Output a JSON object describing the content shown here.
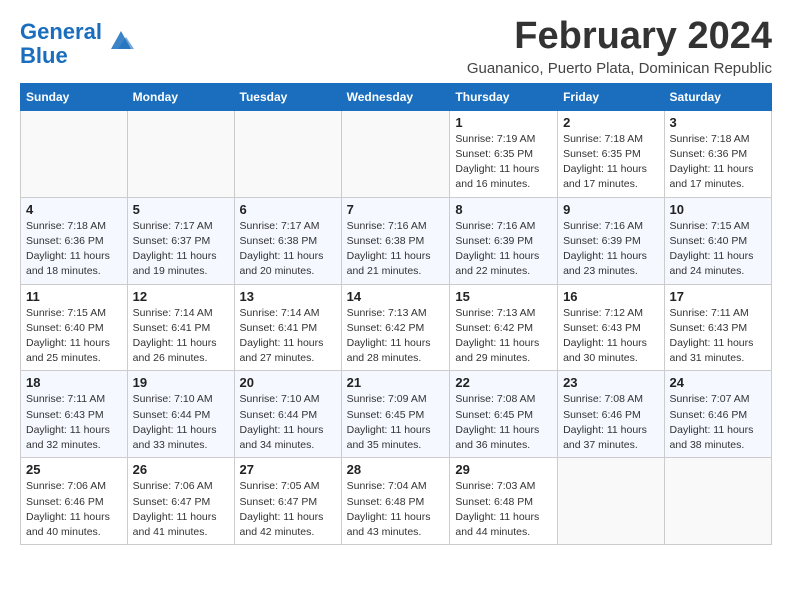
{
  "logo": {
    "text_general": "General",
    "text_blue": "Blue"
  },
  "title": "February 2024",
  "subtitle": "Guananico, Puerto Plata, Dominican Republic",
  "days_of_week": [
    "Sunday",
    "Monday",
    "Tuesday",
    "Wednesday",
    "Thursday",
    "Friday",
    "Saturday"
  ],
  "weeks": [
    [
      {
        "day": "",
        "info": ""
      },
      {
        "day": "",
        "info": ""
      },
      {
        "day": "",
        "info": ""
      },
      {
        "day": "",
        "info": ""
      },
      {
        "day": "1",
        "info": "Sunrise: 7:19 AM\nSunset: 6:35 PM\nDaylight: 11 hours and 16 minutes."
      },
      {
        "day": "2",
        "info": "Sunrise: 7:18 AM\nSunset: 6:35 PM\nDaylight: 11 hours and 17 minutes."
      },
      {
        "day": "3",
        "info": "Sunrise: 7:18 AM\nSunset: 6:36 PM\nDaylight: 11 hours and 17 minutes."
      }
    ],
    [
      {
        "day": "4",
        "info": "Sunrise: 7:18 AM\nSunset: 6:36 PM\nDaylight: 11 hours and 18 minutes."
      },
      {
        "day": "5",
        "info": "Sunrise: 7:17 AM\nSunset: 6:37 PM\nDaylight: 11 hours and 19 minutes."
      },
      {
        "day": "6",
        "info": "Sunrise: 7:17 AM\nSunset: 6:38 PM\nDaylight: 11 hours and 20 minutes."
      },
      {
        "day": "7",
        "info": "Sunrise: 7:16 AM\nSunset: 6:38 PM\nDaylight: 11 hours and 21 minutes."
      },
      {
        "day": "8",
        "info": "Sunrise: 7:16 AM\nSunset: 6:39 PM\nDaylight: 11 hours and 22 minutes."
      },
      {
        "day": "9",
        "info": "Sunrise: 7:16 AM\nSunset: 6:39 PM\nDaylight: 11 hours and 23 minutes."
      },
      {
        "day": "10",
        "info": "Sunrise: 7:15 AM\nSunset: 6:40 PM\nDaylight: 11 hours and 24 minutes."
      }
    ],
    [
      {
        "day": "11",
        "info": "Sunrise: 7:15 AM\nSunset: 6:40 PM\nDaylight: 11 hours and 25 minutes."
      },
      {
        "day": "12",
        "info": "Sunrise: 7:14 AM\nSunset: 6:41 PM\nDaylight: 11 hours and 26 minutes."
      },
      {
        "day": "13",
        "info": "Sunrise: 7:14 AM\nSunset: 6:41 PM\nDaylight: 11 hours and 27 minutes."
      },
      {
        "day": "14",
        "info": "Sunrise: 7:13 AM\nSunset: 6:42 PM\nDaylight: 11 hours and 28 minutes."
      },
      {
        "day": "15",
        "info": "Sunrise: 7:13 AM\nSunset: 6:42 PM\nDaylight: 11 hours and 29 minutes."
      },
      {
        "day": "16",
        "info": "Sunrise: 7:12 AM\nSunset: 6:43 PM\nDaylight: 11 hours and 30 minutes."
      },
      {
        "day": "17",
        "info": "Sunrise: 7:11 AM\nSunset: 6:43 PM\nDaylight: 11 hours and 31 minutes."
      }
    ],
    [
      {
        "day": "18",
        "info": "Sunrise: 7:11 AM\nSunset: 6:43 PM\nDaylight: 11 hours and 32 minutes."
      },
      {
        "day": "19",
        "info": "Sunrise: 7:10 AM\nSunset: 6:44 PM\nDaylight: 11 hours and 33 minutes."
      },
      {
        "day": "20",
        "info": "Sunrise: 7:10 AM\nSunset: 6:44 PM\nDaylight: 11 hours and 34 minutes."
      },
      {
        "day": "21",
        "info": "Sunrise: 7:09 AM\nSunset: 6:45 PM\nDaylight: 11 hours and 35 minutes."
      },
      {
        "day": "22",
        "info": "Sunrise: 7:08 AM\nSunset: 6:45 PM\nDaylight: 11 hours and 36 minutes."
      },
      {
        "day": "23",
        "info": "Sunrise: 7:08 AM\nSunset: 6:46 PM\nDaylight: 11 hours and 37 minutes."
      },
      {
        "day": "24",
        "info": "Sunrise: 7:07 AM\nSunset: 6:46 PM\nDaylight: 11 hours and 38 minutes."
      }
    ],
    [
      {
        "day": "25",
        "info": "Sunrise: 7:06 AM\nSunset: 6:46 PM\nDaylight: 11 hours and 40 minutes."
      },
      {
        "day": "26",
        "info": "Sunrise: 7:06 AM\nSunset: 6:47 PM\nDaylight: 11 hours and 41 minutes."
      },
      {
        "day": "27",
        "info": "Sunrise: 7:05 AM\nSunset: 6:47 PM\nDaylight: 11 hours and 42 minutes."
      },
      {
        "day": "28",
        "info": "Sunrise: 7:04 AM\nSunset: 6:48 PM\nDaylight: 11 hours and 43 minutes."
      },
      {
        "day": "29",
        "info": "Sunrise: 7:03 AM\nSunset: 6:48 PM\nDaylight: 11 hours and 44 minutes."
      },
      {
        "day": "",
        "info": ""
      },
      {
        "day": "",
        "info": ""
      }
    ]
  ]
}
